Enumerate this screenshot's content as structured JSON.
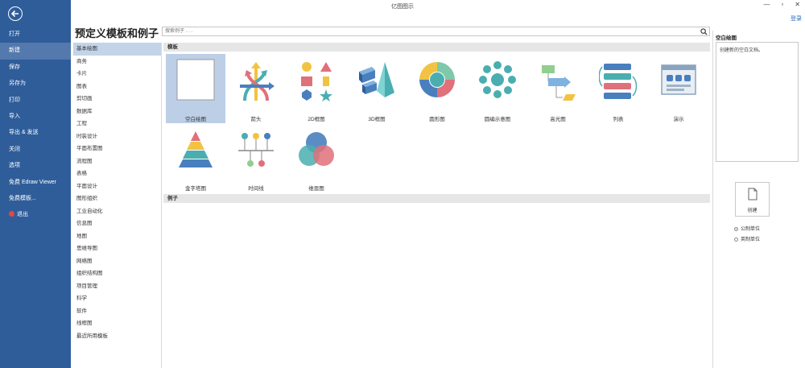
{
  "window": {
    "title": "亿图图示",
    "login": "登录",
    "controls": [
      "—",
      "▫",
      "✕"
    ]
  },
  "sidebar": {
    "items": [
      {
        "label": "打开",
        "active": false
      },
      {
        "label": "新建",
        "active": true
      },
      {
        "label": "保存",
        "active": false
      },
      {
        "label": "另存为",
        "active": false
      },
      {
        "label": "打印",
        "active": false
      },
      {
        "label": "导入",
        "active": false
      },
      {
        "label": "导出 & 发送",
        "active": false
      },
      {
        "label": "关闭",
        "active": false
      },
      {
        "label": "选项",
        "active": false
      },
      {
        "label": "免费 Edraw Viewer",
        "active": false
      },
      {
        "label": "免费模板...",
        "active": false
      },
      {
        "label": "退出",
        "active": false
      }
    ]
  },
  "main": {
    "title": "预定义模板和例子",
    "search": {
      "placeholder": "搜索例子 . . .",
      "value": ""
    }
  },
  "categories": [
    "基本绘图",
    "商务",
    "卡片",
    "图表",
    "剪切画",
    "数据库",
    "工程",
    "时装设计",
    "平面布置图",
    "流程图",
    "表格",
    "平面设计",
    "图形组织",
    "工业自动化",
    "信息图",
    "地图",
    "思维导图",
    "网络图",
    "组织结构图",
    "项目管理",
    "科学",
    "软件",
    "线框图",
    "最近所用模板"
  ],
  "templates": {
    "header": "模板",
    "items": [
      {
        "label": "空白绘图",
        "icon": "blank-page-icon"
      },
      {
        "label": "箭头",
        "icon": "arrows-icon"
      },
      {
        "label": "2D框图",
        "icon": "shapes-2d-icon"
      },
      {
        "label": "3D框图",
        "icon": "shapes-3d-icon"
      },
      {
        "label": "圆形图",
        "icon": "circle-chart-icon"
      },
      {
        "label": "圆编示意图",
        "icon": "circle-spoke-icon"
      },
      {
        "label": "高光图",
        "icon": "highlight-icon"
      },
      {
        "label": "列表",
        "icon": "list-icon"
      },
      {
        "label": "演示",
        "icon": "presentation-icon"
      },
      {
        "label": "金字塔图",
        "icon": "pyramid-icon"
      },
      {
        "label": "时间线",
        "icon": "timeline-icon"
      },
      {
        "label": "维恩图",
        "icon": "venn-icon"
      }
    ]
  },
  "examples": {
    "header": "例子"
  },
  "right_panel": {
    "title": "空白绘图",
    "description": "创建新的空白文档。",
    "create_label": "创建",
    "units": [
      {
        "label": "公制单位",
        "selected": true
      },
      {
        "label": "英制单位",
        "selected": false
      }
    ]
  },
  "colors": {
    "sidebar": "#2f5d9a",
    "sidebar_active": "#5479ad",
    "selection": "#bccfe6",
    "accent_teal": "#4aaeb0",
    "accent_red": "#e0707a",
    "accent_yellow": "#f2c342",
    "accent_blue": "#4a7fbe"
  }
}
